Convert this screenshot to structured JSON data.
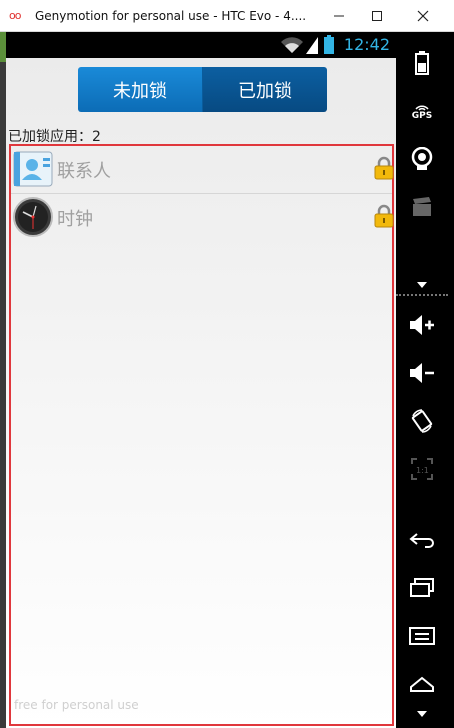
{
  "window": {
    "title": "Genymotion for personal use - HTC Evo - 4....",
    "logo": "oo"
  },
  "statusbar": {
    "time": "12:42"
  },
  "app": {
    "tabs": [
      {
        "label": "未加锁",
        "selected": false
      },
      {
        "label": "已加锁",
        "selected": true
      }
    ],
    "count_label": "已加锁应用：2",
    "apps": [
      {
        "name": "联系人",
        "icon": "contacts-icon",
        "locked": true
      },
      {
        "name": "时钟",
        "icon": "clock-icon",
        "locked": true
      }
    ],
    "watermark": "free for personal use"
  },
  "panel": {
    "gps_label": "GPS",
    "buttons": [
      "battery-icon",
      "gps-icon",
      "camera-icon",
      "media-icon",
      "volume-up-icon",
      "volume-down-icon",
      "rotate-icon",
      "pixel-perfect-icon",
      "back-icon",
      "recent-apps-icon",
      "menu-icon",
      "home-icon"
    ]
  },
  "colors": {
    "accent": "#33b5e5",
    "selection_border": "#e0373c",
    "tab_blue": "#1a8ad8"
  }
}
